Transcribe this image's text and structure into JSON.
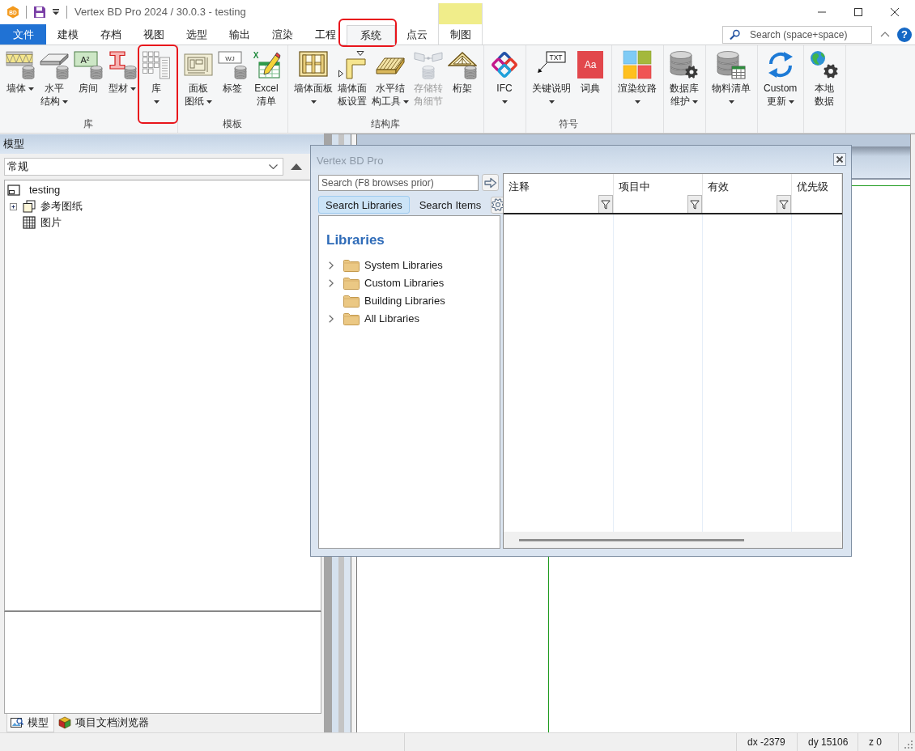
{
  "window": {
    "icon_text": "BD",
    "title": "Vertex BD Pro 2024 / 30.0.3 - testing"
  },
  "tabs": [
    {
      "label": "文件",
      "kind": "file",
      "selected": false,
      "highlighted": false
    },
    {
      "label": "建模",
      "kind": "tab",
      "selected": false,
      "highlighted": false
    },
    {
      "label": "存档",
      "kind": "tab",
      "selected": false,
      "highlighted": false
    },
    {
      "label": "视图",
      "kind": "tab",
      "selected": false,
      "highlighted": false
    },
    {
      "label": "选型",
      "kind": "tab",
      "selected": false,
      "highlighted": false
    },
    {
      "label": "输出",
      "kind": "tab",
      "selected": false,
      "highlighted": false
    },
    {
      "label": "渲染",
      "kind": "tab",
      "selected": false,
      "highlighted": false
    },
    {
      "label": "工程",
      "kind": "tab",
      "selected": false,
      "highlighted": false
    },
    {
      "label": "系统",
      "kind": "tab",
      "selected": true,
      "highlighted": true
    },
    {
      "label": "点云",
      "kind": "tab",
      "selected": false,
      "highlighted": false
    },
    {
      "label": "制图",
      "kind": "tab",
      "selected": false,
      "highlighted": false,
      "color": "#f0ed8a"
    }
  ],
  "search": {
    "placeholder": "Search (space+space)"
  },
  "help_button": {
    "label": "?"
  },
  "ribbon": {
    "groups": [
      {
        "label": "库",
        "buttons": [
          {
            "lines": [
              "墙体"
            ],
            "kind": "menu",
            "disabled": false,
            "highlighted": false
          },
          {
            "lines": [
              "水平",
              "结构"
            ],
            "kind": "menu",
            "disabled": false,
            "highlighted": false
          },
          {
            "lines": [
              "房间"
            ],
            "icon_text": "A²",
            "kind": "plain",
            "disabled": false,
            "highlighted": false
          },
          {
            "lines": [
              "型材"
            ],
            "kind": "menu",
            "disabled": false,
            "highlighted": false
          },
          {
            "lines": [
              "库"
            ],
            "kind": "split",
            "disabled": false,
            "highlighted": true
          }
        ]
      },
      {
        "label": "模板",
        "buttons": [
          {
            "lines": [
              "面板",
              "图纸"
            ],
            "kind": "menu",
            "disabled": false,
            "highlighted": false
          },
          {
            "lines": [
              "标签"
            ],
            "icon_text": "WJ",
            "kind": "plain",
            "disabled": false,
            "highlighted": false
          },
          {
            "lines": [
              "Excel",
              "清单"
            ],
            "icon_text": "X",
            "kind": "plain",
            "disabled": false,
            "highlighted": false
          }
        ]
      },
      {
        "label": "结构库",
        "buttons": [
          {
            "lines": [
              "墙体面板"
            ],
            "kind": "split",
            "disabled": false,
            "highlighted": false
          },
          {
            "lines": [
              "墙体面",
              "板设置"
            ],
            "kind": "plain",
            "disabled": false,
            "highlighted": false
          },
          {
            "lines": [
              "水平结",
              "构工具"
            ],
            "kind": "menu",
            "disabled": false,
            "highlighted": false
          },
          {
            "lines": [
              "存储转",
              "角细节"
            ],
            "kind": "plain",
            "disabled": true,
            "highlighted": false
          },
          {
            "lines": [
              "桁架"
            ],
            "kind": "plain",
            "disabled": false,
            "highlighted": false
          }
        ]
      },
      {
        "buttons": [
          {
            "lines": [
              "IFC"
            ],
            "kind": "split",
            "disabled": false,
            "highlighted": false
          }
        ]
      },
      {
        "label": "符号",
        "buttons": [
          {
            "lines": [
              "关键说明"
            ],
            "icon_text": "TXT",
            "kind": "split",
            "disabled": false,
            "highlighted": false
          },
          {
            "lines": [
              "词典"
            ],
            "icon_text": "Aa",
            "kind": "plain",
            "disabled": false,
            "highlighted": false
          }
        ]
      },
      {
        "buttons": [
          {
            "lines": [
              "渲染纹路"
            ],
            "kind": "split",
            "disabled": false,
            "highlighted": false
          }
        ]
      },
      {
        "buttons": [
          {
            "lines": [
              "数据库",
              "维护"
            ],
            "kind": "menu",
            "disabled": false,
            "highlighted": false
          }
        ]
      },
      {
        "buttons": [
          {
            "lines": [
              "物料清单"
            ],
            "kind": "split",
            "disabled": false,
            "highlighted": false
          }
        ]
      },
      {
        "buttons": [
          {
            "lines": [
              "Custom",
              "更新"
            ],
            "kind": "menu",
            "disabled": false,
            "highlighted": false
          }
        ]
      },
      {
        "buttons": [
          {
            "lines": [
              "本地",
              "数据"
            ],
            "kind": "plain",
            "disabled": false,
            "highlighted": false
          }
        ]
      }
    ]
  },
  "model_panel": {
    "title": "模型",
    "view_select": {
      "value": "常规"
    },
    "tree": [
      {
        "label": "testing",
        "kind": "drawing",
        "children": [
          {
            "label": "参考图纸",
            "kind": "sheet-set",
            "expandable": true
          },
          {
            "label": "图片",
            "kind": "image",
            "expandable": false
          }
        ]
      }
    ],
    "bottom_tabs": [
      {
        "label": "模型",
        "kind": "model",
        "selected": true
      },
      {
        "label": "项目文档浏览器",
        "kind": "documents",
        "selected": false
      }
    ]
  },
  "library_dialog": {
    "title": "Vertex BD Pro",
    "search": {
      "placeholder": "Search (F8 browses prior)"
    },
    "tabs": [
      {
        "label": "Search Libraries",
        "selected": true
      },
      {
        "label": "Search Items",
        "selected": false
      }
    ],
    "heading": "Libraries",
    "libraries": [
      {
        "label": "System Libraries",
        "expandable": true
      },
      {
        "label": "Custom Libraries",
        "expandable": true
      },
      {
        "label": "Building Libraries",
        "expandable": false
      },
      {
        "label": "All Libraries",
        "expandable": true
      }
    ],
    "columns": [
      {
        "label": "注释",
        "filter": true
      },
      {
        "label": "项目中",
        "filter": true
      },
      {
        "label": "有效",
        "filter": true
      },
      {
        "label": "优先级",
        "filter": false
      }
    ]
  },
  "status_bar": [
    "dx -2379",
    "dy 15106",
    "z 0"
  ]
}
